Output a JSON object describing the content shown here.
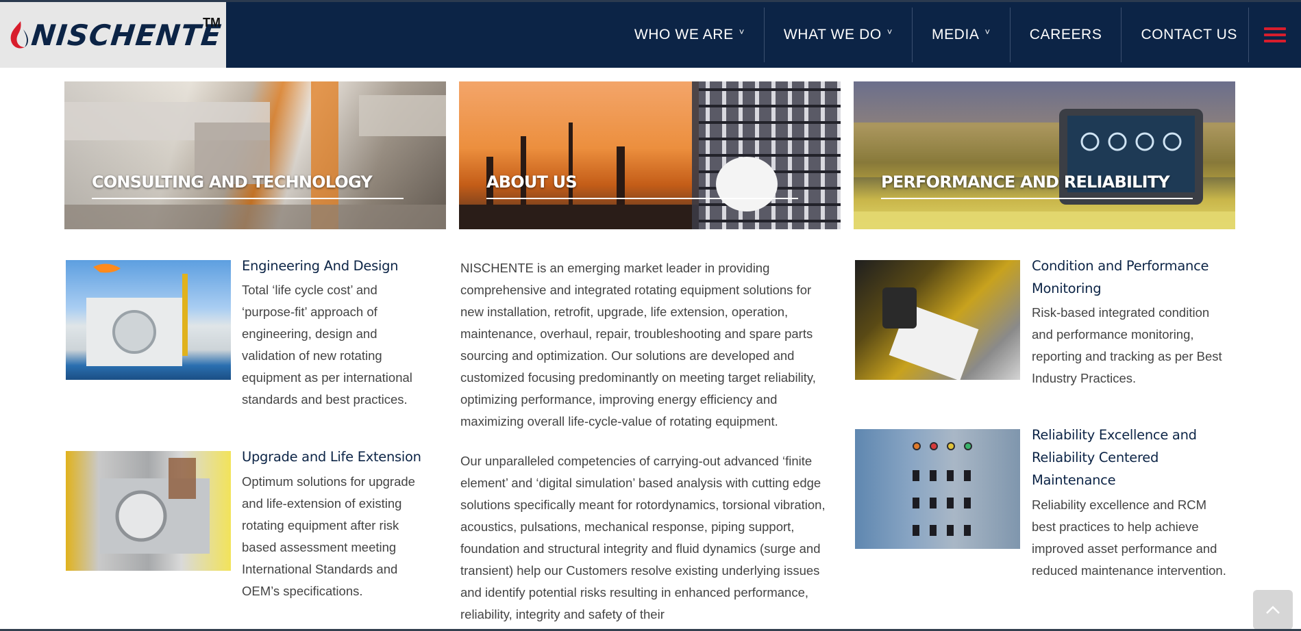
{
  "header": {
    "logo_text": "NISCHENTE",
    "logo_tm": "TM",
    "nav": [
      {
        "label": "WHO WE ARE",
        "dropdown": true
      },
      {
        "label": "WHAT WE DO",
        "dropdown": true
      },
      {
        "label": "MEDIA",
        "dropdown": true
      },
      {
        "label": "CAREERS",
        "dropdown": false
      },
      {
        "label": "CONTACT US",
        "dropdown": false
      }
    ],
    "caret_glyph": "˅",
    "menu_icon": "hamburger-menu-icon"
  },
  "banners": [
    {
      "title": "CONSULTING AND TECHNOLOGY"
    },
    {
      "title": "ABOUT US"
    },
    {
      "title": "PERFORMANCE AND RELIABILITY"
    }
  ],
  "left_cards": [
    {
      "title": "Engineering And Design",
      "text": "Total ‘life cycle cost’ and ‘purpose-fit’ approach of engineering, design and validation of new rotating equipment as per international standards and best practices."
    },
    {
      "title": "Upgrade and Life Extension",
      "text": "Optimum solutions for upgrade and life-extension of existing rotating equipment after risk based assessment meeting International Standards and OEM’s specifications."
    }
  ],
  "about": {
    "p1": "NISCHENTE is an emerging market leader in providing comprehensive and integrated rotating equipment solutions for new installation, retrofit, upgrade, life extension, operation, maintenance, overhaul, repair, troubleshooting and spare parts sourcing and optimization. Our solutions are developed and customized focusing predominantly on meeting target reliability, optimizing performance, improving energy efficiency and maximizing overall life-cycle-value of rotating equipment.",
    "p2": "Our unparalleled competencies of carrying-out advanced ‘finite element’ and ‘digital simulation’ based analysis with cutting edge solutions specifically meant for rotordynamics, torsional vibration, acoustics, pulsations, mechanical response, piping support, foundation and structural integrity and fluid dynamics (surge and transient) help our Customers resolve existing underlying issues and identify potential risks resulting in enhanced performance, reliability, integrity and safety of their"
  },
  "right_cards": [
    {
      "title": "Condition and Performance Monitoring",
      "text": "Risk-based integrated condition and performance monitoring, reporting and tracking as per Best Industry Practices."
    },
    {
      "title": "Reliability Excellence and Reliability Centered Maintenance",
      "text": "Reliability excellence and RCM best practices to help achieve improved asset performance and reduced maintenance intervention."
    }
  ],
  "back_to_top_icon": "chevron-up-icon",
  "colors": {
    "navy": "#0c2446",
    "accent_red": "#d81d2c",
    "text": "#444444"
  }
}
